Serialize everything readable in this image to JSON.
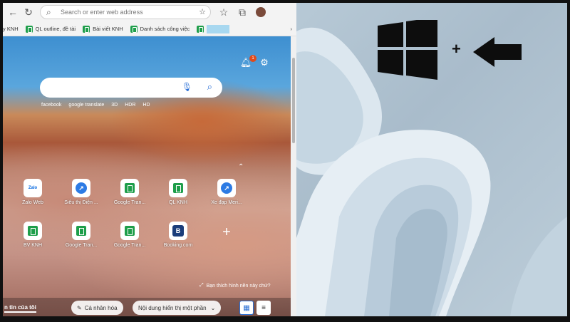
{
  "browser": {
    "address_placeholder": "Search or enter web address",
    "bookmarks": [
      {
        "label": "y KNH"
      },
      {
        "label": "QL outline, đề tài"
      },
      {
        "label": "Bài viết KNH"
      },
      {
        "label": "Danh sách công việc"
      }
    ],
    "notification_count": "1",
    "search_suggestions": [
      "facebook",
      "google translate",
      "3D",
      "HDR",
      "HD"
    ],
    "quick_links": [
      {
        "label": "Zalo Web",
        "icon": "zalo-icon",
        "icon_text": "Zalo"
      },
      {
        "label": "Siêu thị Điện ...",
        "icon": "bike-icon",
        "icon_text": "↗"
      },
      {
        "label": "Google Tran...",
        "icon": "sheets-icon",
        "icon_text": ""
      },
      {
        "label": "QL KNH",
        "icon": "sheets-icon",
        "icon_text": ""
      },
      {
        "label": "Xe đạp Meri...",
        "icon": "bike-icon",
        "icon_text": "↗"
      },
      {
        "label": "BV KNH",
        "icon": "sheets-icon",
        "icon_text": ""
      },
      {
        "label": "Google Tran...",
        "icon": "sheets-icon",
        "icon_text": ""
      },
      {
        "label": "Google Tran...",
        "icon": "sheets-icon",
        "icon_text": ""
      },
      {
        "label": "Booking.com",
        "icon": "booking-icon",
        "icon_text": "B"
      }
    ],
    "image_prompt": "Bạn thích hình nền này chứ?",
    "bottom": {
      "news_tab": "n tin của tôi",
      "personalize": "Cá nhân hóa",
      "content_visible": "Nội dung hiển thị một phần"
    }
  },
  "shortcut": {
    "plus": "+"
  },
  "colors": {
    "accent": "#2a6fd6",
    "sheets_green": "#1e9e4a",
    "badge": "#e04a1a"
  }
}
